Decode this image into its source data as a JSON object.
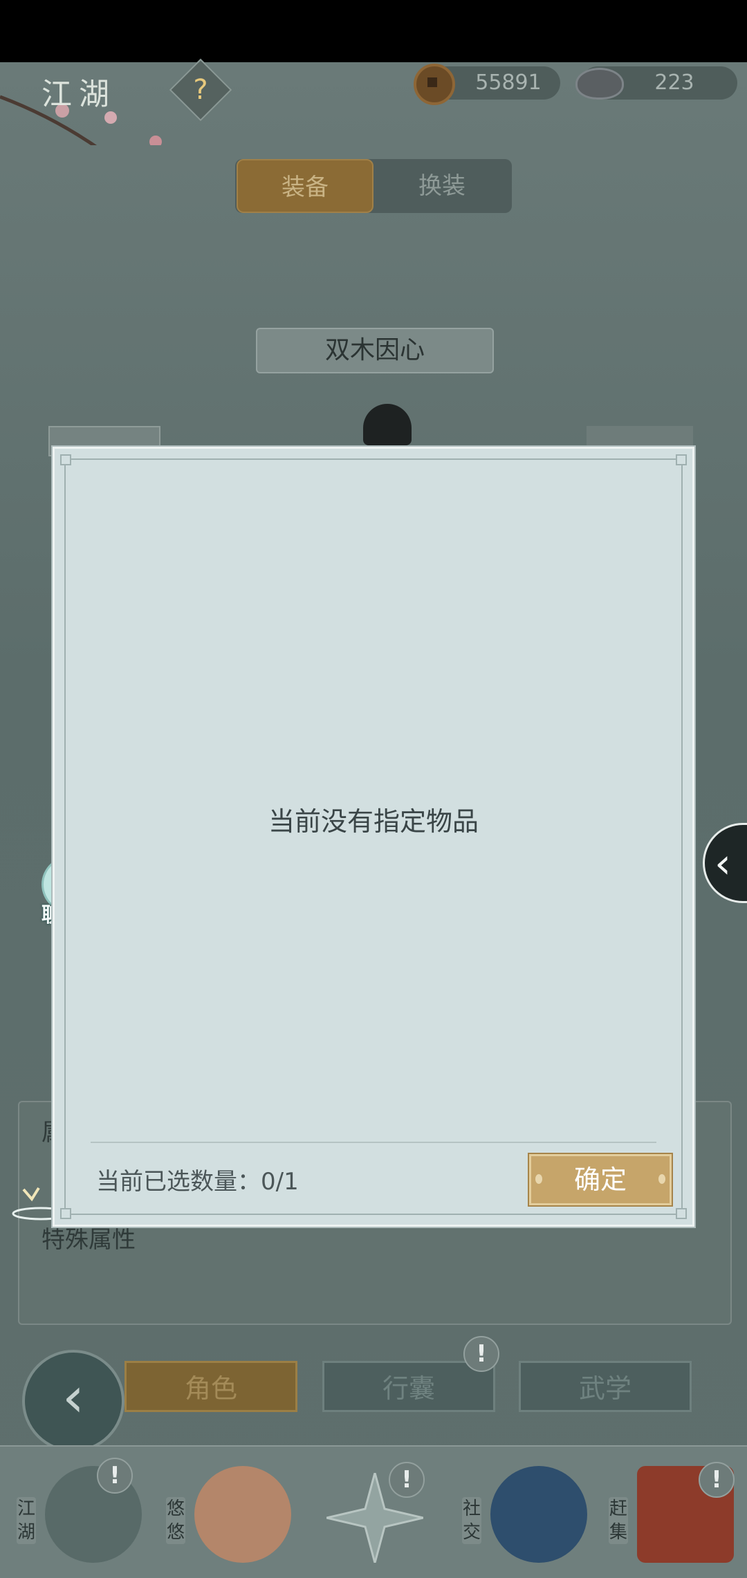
{
  "header": {
    "title": "江湖",
    "help_icon": "?"
  },
  "currency": {
    "copper": "55891",
    "silver": "223"
  },
  "tabs": [
    {
      "label": "装备"
    },
    {
      "label": "换装"
    }
  ],
  "character": {
    "name": "双木因心"
  },
  "panel": {
    "special_attr": "特殊属性",
    "partial": "属"
  },
  "chat": {
    "label": "聊天"
  },
  "nav": {
    "role": "角色",
    "bag": "行囊",
    "skill": "武学",
    "alert": "!"
  },
  "dock": [
    {
      "label": "江湖"
    },
    {
      "label": "悠悠"
    },
    {
      "label": ""
    },
    {
      "label": "社交"
    },
    {
      "label": "赶集"
    }
  ],
  "modal": {
    "empty_message": "当前没有指定物品",
    "count_text": "当前已选数量：0/1",
    "confirm_label": "确定"
  },
  "colors": {
    "accent_gold": "#c6a56a",
    "modal_bg": "#d2dfe0",
    "app_bg": "#5e6f6d"
  }
}
